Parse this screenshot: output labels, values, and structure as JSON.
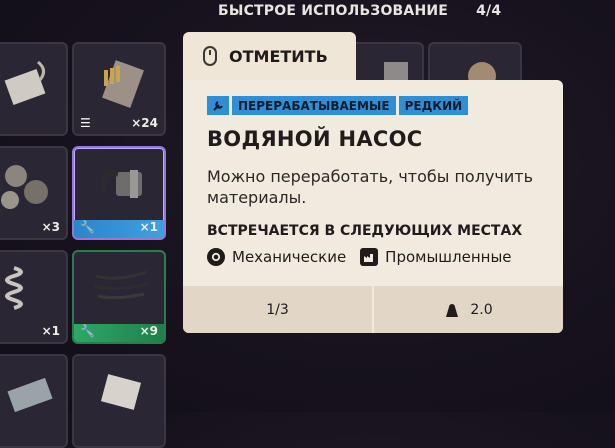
{
  "header": {
    "title": "БЫСТРОЕ ИСПОЛЬЗОВАНИЕ",
    "counter": "4/4"
  },
  "mark_tab": {
    "label": "ОТМЕТИТЬ",
    "icon": "mouse-icon"
  },
  "tooltip": {
    "tags": [
      "ПЕРЕРАБАТЫВАЕМЫЕ",
      "РЕДКИЙ"
    ],
    "title": "ВОДЯНОЙ НАСОС",
    "description": "Можно переработать, чтобы получить материалы.",
    "found_heading": "ВСТРЕЧАЕТСЯ В СЛЕДУЮЩИХ МЕСТАХ",
    "locations": [
      "Механические",
      "Промышленные"
    ],
    "stack": "1/3",
    "weight": "2.0"
  },
  "grid": {
    "counts": [
      "×24",
      "×3",
      "×1",
      "×1",
      "×9"
    ]
  },
  "colors": {
    "tag_blue": "#2f8fd6",
    "rare_stripe": "#2b86c9",
    "green_stripe": "#2da866",
    "panel": "#f1eadf"
  }
}
